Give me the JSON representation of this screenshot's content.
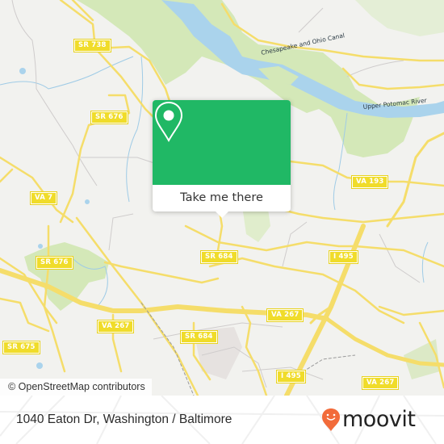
{
  "map": {
    "road_labels": [
      {
        "id": "sr738",
        "text": "SR 738"
      },
      {
        "id": "sr676a",
        "text": "SR 676"
      },
      {
        "id": "va7",
        "text": "VA 7"
      },
      {
        "id": "sr676b",
        "text": "SR 676"
      },
      {
        "id": "sr675",
        "text": "SR 675"
      },
      {
        "id": "va267a",
        "text": "VA 267"
      },
      {
        "id": "sr684a",
        "text": "SR 684"
      },
      {
        "id": "sr684b",
        "text": "SR 684"
      },
      {
        "id": "va267b",
        "text": "VA 267"
      },
      {
        "id": "i495a",
        "text": "I 495"
      },
      {
        "id": "i495b",
        "text": "I 495"
      },
      {
        "id": "va267c",
        "text": "VA 267"
      },
      {
        "id": "va193",
        "text": "VA 193"
      }
    ],
    "water_labels": {
      "canal": "Chesapeake and Ohio Canal",
      "river": "Upper Potomac River"
    },
    "colors": {
      "land": "#f2f2ef",
      "park": "#d4e8b8",
      "water": "#aad3ec",
      "road": "#f5dd6a",
      "highway_shield": "#f0dc2a",
      "popup_green": "#20b865",
      "moovit_orange": "#f26b3a"
    },
    "attribution": "© OpenStreetMap contributors"
  },
  "popup": {
    "icon": "location-pin-icon",
    "button_label": "Take me there"
  },
  "footer": {
    "address": "1040 Eaton Dr, Washington / Baltimore",
    "logo_text": "moovit",
    "logo_icon": "moovit-smiley-pin-icon"
  }
}
